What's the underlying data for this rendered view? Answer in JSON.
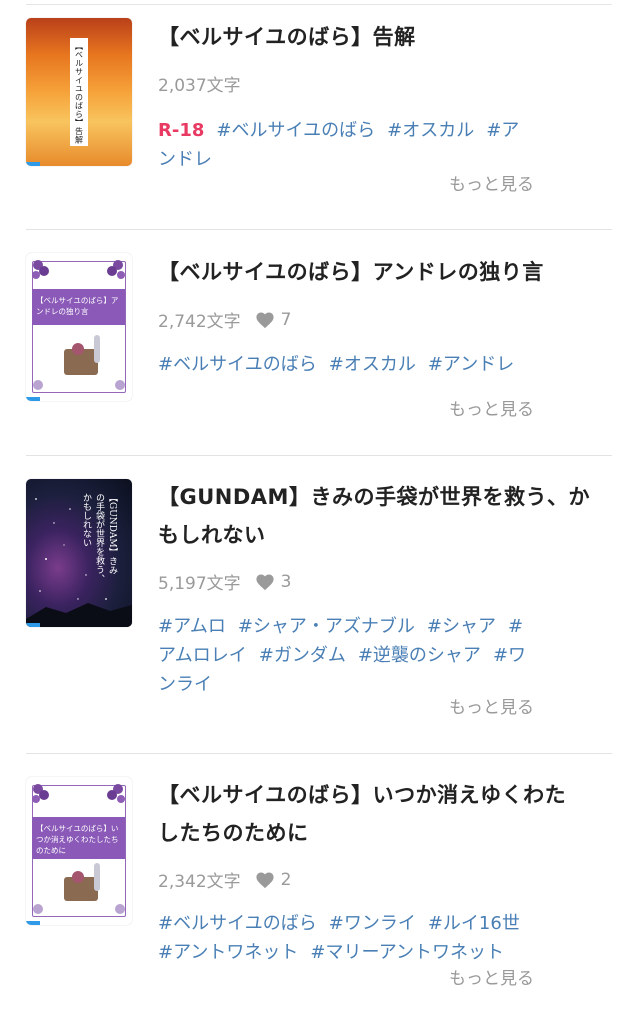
{
  "works": [
    {
      "title": "【ベルサイユのばら】告解",
      "chars": "2,037文字",
      "likes": "",
      "rating": "R-18",
      "tags": [
        "#ベルサイユのばら",
        "#オスカル",
        "#ア",
        "ンドレ"
      ],
      "more": "もっと見る",
      "cover_text": "【ベルサイユのばら】告解",
      "cover_style": "sunset"
    },
    {
      "title": "【ベルサイユのばら】アンドレの独り言",
      "chars": "2,742文字",
      "likes": "7",
      "rating": "",
      "tags": [
        "#ベルサイユのばら",
        "#オスカル",
        "#アンドレ"
      ],
      "more": "もっと見る",
      "cover_text": "【ベルサイユのばら】アンドレの独り言",
      "cover_style": "grape"
    },
    {
      "title": "【GUNDAM】きみの手袋が世界を救う、かもしれない",
      "title_lines": [
        "【GUNDAM】きみの手袋が世界を救う、か",
        "もしれない"
      ],
      "chars": "5,197文字",
      "likes": "3",
      "rating": "",
      "tags": [
        "#アムロ",
        "#シャア・アズナブル",
        "#シャア",
        "#",
        "アムロレイ",
        "#ガンダム",
        "#逆襲のシャア",
        "#ワ",
        "ンライ"
      ],
      "more": "もっと見る",
      "cover_text": "【GUNDAM】きみの手袋が世界を救う、かもしれない",
      "cover_style": "space"
    },
    {
      "title": "【ベルサイユのばら】いつか消えゆくわたしたちのために",
      "title_lines": [
        "【ベルサイユのばら】いつか消えゆくわた",
        "したちのために"
      ],
      "chars": "2,342文字",
      "likes": "2",
      "rating": "",
      "tags": [
        "#ベルサイユのばら",
        "#ワンライ",
        "#ルイ16世",
        "#アントワネット",
        "#マリーアントワネット"
      ],
      "more": "もっと見る",
      "cover_text": "【ベルサイユのばら】いつか消えゆくわたしたちのために",
      "cover_style": "grape"
    }
  ]
}
